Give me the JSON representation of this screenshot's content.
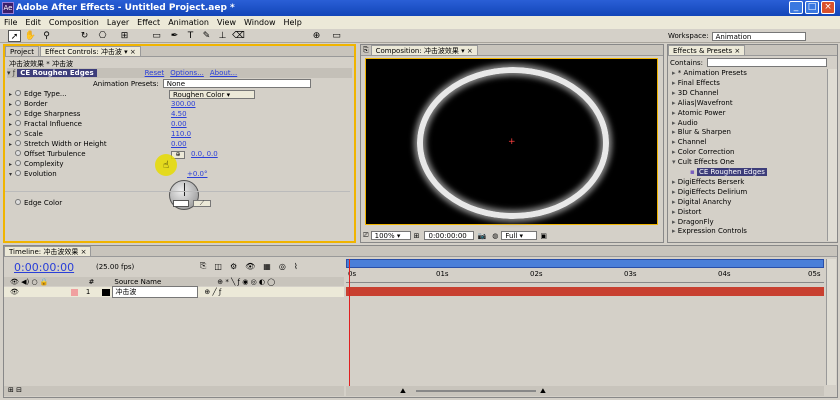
{
  "window": {
    "title": "Adobe After Effects - Untitled Project.aep *",
    "app_icon": "Ae"
  },
  "menu": [
    "File",
    "Edit",
    "Composition",
    "Layer",
    "Effect",
    "Animation",
    "View",
    "Window",
    "Help"
  ],
  "workspace": {
    "label": "Workspace:",
    "value": "Animation"
  },
  "panels": {
    "project_tab": "Project",
    "effect_controls_tab": "Effect Controls: 冲击波",
    "composition_tab": "Composition: 冲击波效果",
    "effects_presets_tab": "Effects & Presets"
  },
  "effect_controls": {
    "breadcrumb": "冲击波效果 * 冲击波",
    "effect_name": "CE Roughen Edges",
    "reset": "Reset",
    "options": "Options...",
    "about": "About...",
    "presets_label": "Animation Presets:",
    "presets_value": "None",
    "props": [
      {
        "name": "Edge Type...",
        "value": "Roughen Color"
      },
      {
        "name": "Border",
        "value": "300.00"
      },
      {
        "name": "Edge Sharpness",
        "value": "4.50"
      },
      {
        "name": "Fractal Influence",
        "value": "0.00"
      },
      {
        "name": "Scale",
        "value": "110.0"
      },
      {
        "name": "Stretch Width or Height",
        "value": "0.00"
      },
      {
        "name": "Offset Turbulence",
        "value": "0.0, 0.0"
      },
      {
        "name": "Complexity",
        "value": ""
      },
      {
        "name": "Evolution",
        "value": "+0.0°"
      }
    ],
    "edge_color_label": "Edge Color"
  },
  "composition": {
    "zoom": "100%",
    "timecode": "0:00:00:00",
    "resolution": "Full"
  },
  "effects_presets": {
    "contains_label": "Contains:",
    "items": [
      {
        "label": "* Animation Presets",
        "indent": 0,
        "open": false
      },
      {
        "label": "Final Effects",
        "indent": 0,
        "open": false
      },
      {
        "label": "3D Channel",
        "indent": 0,
        "open": false
      },
      {
        "label": "Alias|Wavefront",
        "indent": 0,
        "open": false
      },
      {
        "label": "Atomic Power",
        "indent": 0,
        "open": false
      },
      {
        "label": "Audio",
        "indent": 0,
        "open": false
      },
      {
        "label": "Blur & Sharpen",
        "indent": 0,
        "open": false
      },
      {
        "label": "Channel",
        "indent": 0,
        "open": false
      },
      {
        "label": "Color Correction",
        "indent": 0,
        "open": false
      },
      {
        "label": "Cult Effects One",
        "indent": 0,
        "open": true
      },
      {
        "label": "CE Roughen Edges",
        "indent": 1,
        "selected": true
      },
      {
        "label": "DigiEffects Berserk",
        "indent": 0,
        "open": false
      },
      {
        "label": "DigiEffects Delirium",
        "indent": 0,
        "open": false
      },
      {
        "label": "Digital Anarchy",
        "indent": 0,
        "open": false
      },
      {
        "label": "Distort",
        "indent": 0,
        "open": false
      },
      {
        "label": "DragonFly",
        "indent": 0,
        "open": false
      },
      {
        "label": "Expression Controls",
        "indent": 0,
        "open": false
      }
    ]
  },
  "timeline": {
    "tab": "Timeline: 冲击波效果",
    "timecode": "0:00:00:00",
    "fps": "(25.00 fps)",
    "col_hash": "#",
    "col_source": "Source Name",
    "ruler": [
      "0s",
      "01s",
      "02s",
      "03s",
      "04s",
      "05s"
    ],
    "layers": [
      {
        "num": "1",
        "name": "冲击波"
      }
    ]
  },
  "colors": {
    "accent_orange": "#f0b400",
    "value_blue": "#2a3fd8",
    "layer_bar": "#c84030",
    "time_indicator": "#e02020"
  }
}
